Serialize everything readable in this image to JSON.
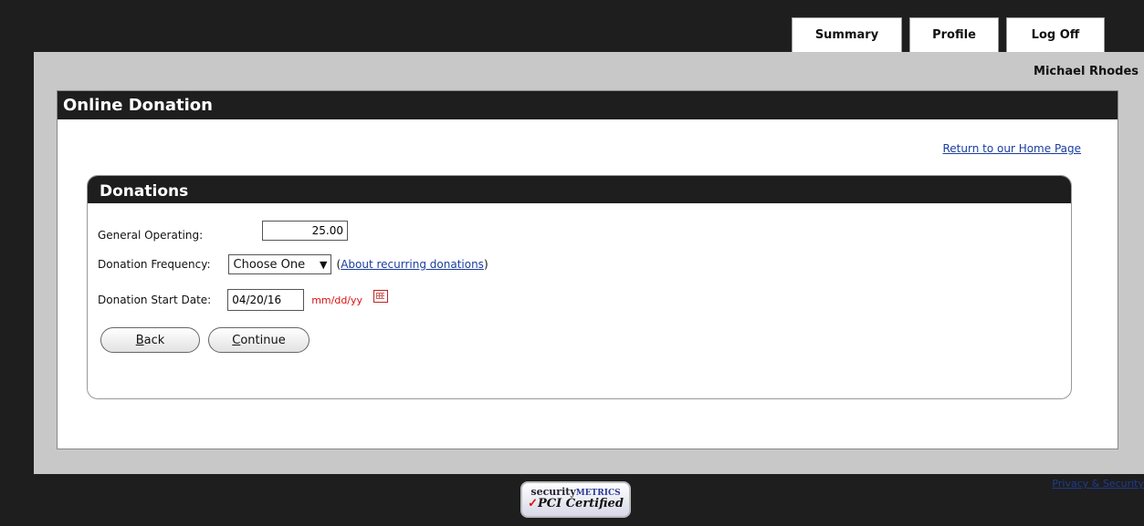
{
  "nav": {
    "tabs": [
      "Summary",
      "Profile",
      "Log Off"
    ]
  },
  "user": {
    "name": "Michael Rhodes"
  },
  "page": {
    "title": "Online Donation",
    "home_link": "Return to our Home Page"
  },
  "donations": {
    "title": "Donations",
    "general_operating_label": "General Operating:",
    "general_operating_value": "25.00",
    "frequency_label": "Donation Frequency:",
    "frequency_selected": "Choose One",
    "about_recurring_link": "About recurring donations",
    "start_date_label": "Donation Start Date:",
    "start_date_value": "04/20/16",
    "date_format_hint": "mm/dd/yy",
    "back_button": {
      "accesskey_char": "B",
      "rest": "ack"
    },
    "continue_button": {
      "accesskey_char": "C",
      "rest": "ontinue"
    }
  },
  "footer": {
    "privacy_link": "Privacy & Security",
    "badge_line1_a": "security",
    "badge_line1_b": "METRICS",
    "badge_line2_check": "✓",
    "badge_line2": "PCI Certified"
  }
}
